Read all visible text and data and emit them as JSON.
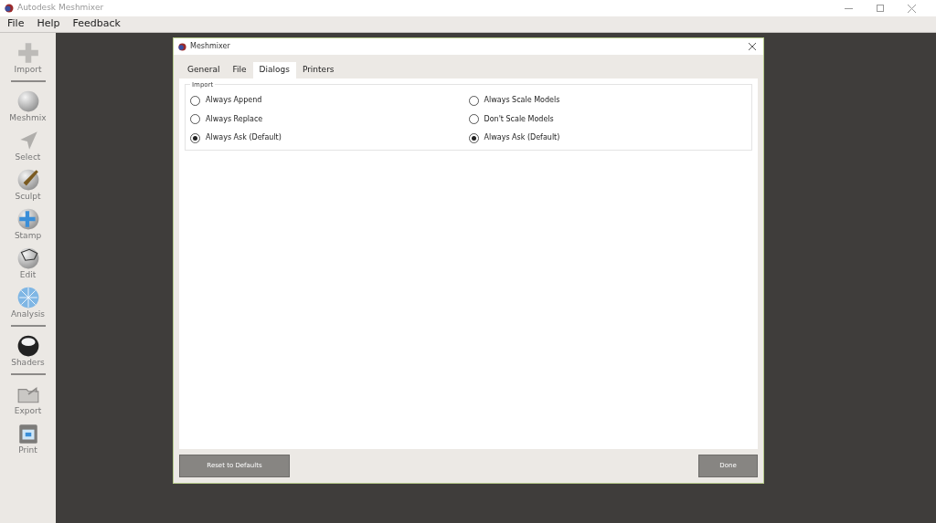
{
  "window": {
    "title": "Autodesk Meshmixer"
  },
  "menu": [
    "File",
    "Help",
    "Feedback"
  ],
  "sidebar": {
    "groups": [
      {
        "items": [
          "Import"
        ]
      },
      {
        "items": [
          "Meshmix",
          "Select",
          "Sculpt",
          "Stamp",
          "Edit",
          "Analysis"
        ]
      },
      {
        "items": [
          "Shaders"
        ]
      },
      {
        "items": [
          "Export",
          "Print"
        ]
      }
    ]
  },
  "dialog": {
    "title": "Meshmixer",
    "tabs": [
      {
        "label": "General",
        "selected": false
      },
      {
        "label": "File",
        "selected": false
      },
      {
        "label": "Dialogs",
        "selected": true
      },
      {
        "label": "Printers",
        "selected": false
      }
    ],
    "group": {
      "legend": "Import",
      "columns": [
        {
          "options": [
            {
              "label": "Always Append",
              "selected": false
            },
            {
              "label": "Always Replace",
              "selected": false
            },
            {
              "label": "Always Ask (Default)",
              "selected": true
            }
          ]
        },
        {
          "options": [
            {
              "label": "Always Scale Models",
              "selected": false
            },
            {
              "label": "Don't Scale Models",
              "selected": false
            },
            {
              "label": "Always Ask (Default)",
              "selected": true
            }
          ]
        }
      ]
    },
    "buttons": {
      "reset": "Reset to Defaults",
      "done": "Done"
    }
  }
}
